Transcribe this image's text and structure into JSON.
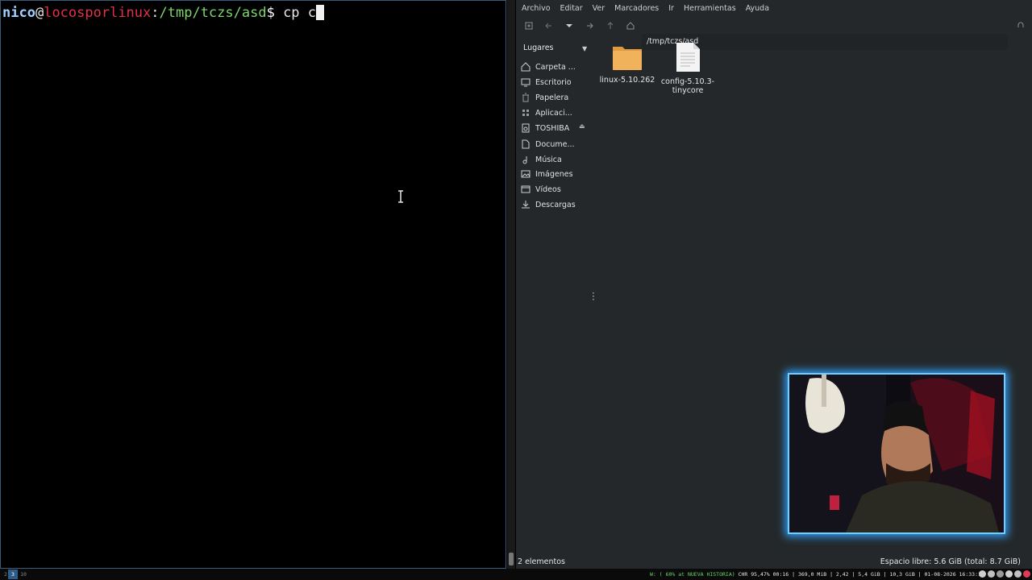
{
  "terminal": {
    "user": "nico",
    "at": "@",
    "host": "locosporlinux",
    "colon": ":",
    "path": "/tmp/tczs/asd",
    "dollar": "$",
    "command": " cp c"
  },
  "file_manager": {
    "menu": [
      "Archivo",
      "Editar",
      "Ver",
      "Marcadores",
      "Ir",
      "Herramientas",
      "Ayuda"
    ],
    "path": "/tmp/tczs/asd",
    "sidebar_title": "Lugares",
    "places": [
      {
        "label": "Carpeta ...",
        "icon": "home-icon"
      },
      {
        "label": "Escritorio",
        "icon": "desktop-icon"
      },
      {
        "label": "Papelera",
        "icon": "trash-icon"
      },
      {
        "label": "Aplicaci...",
        "icon": "apps-icon"
      },
      {
        "label": "TOSHIBA",
        "icon": "drive-icon"
      },
      {
        "label": "Docume...",
        "icon": "document-icon"
      },
      {
        "label": "Música",
        "icon": "music-icon"
      },
      {
        "label": "Imágenes",
        "icon": "image-icon"
      },
      {
        "label": "Vídeos",
        "icon": "video-icon"
      },
      {
        "label": "Descargas",
        "icon": "download-icon"
      }
    ],
    "files": [
      {
        "name": "linux-5.10.262",
        "type": "folder"
      },
      {
        "name_line1": "config-5.10.3-",
        "name_line2": "tinycore",
        "type": "text-file"
      }
    ],
    "status_left": "2 elementos",
    "status_right": "Espacio libre: 5.6 GiB (total: 8.7 GiB)"
  },
  "taskbar": {
    "workspaces": [
      "2",
      "3",
      "10"
    ],
    "active_workspace": "3",
    "wifi": "W: ( 60% at NUEVA HISTORIA)",
    "stats": " CHR 95,47% 00:16 | 369,0 MiB | 2,42 | 5,4 GiB | 10,3 GiB | 01-08-2026 16:33:10 |"
  },
  "colors": {
    "terminal_bg": "#000000",
    "prompt_user": "#9fd0ff",
    "prompt_host": "#e0304a",
    "prompt_path": "#7cd46a",
    "fm_bg": "#24282a",
    "webcam_border": "#6fd0ff",
    "folder": "#f0b25a"
  }
}
